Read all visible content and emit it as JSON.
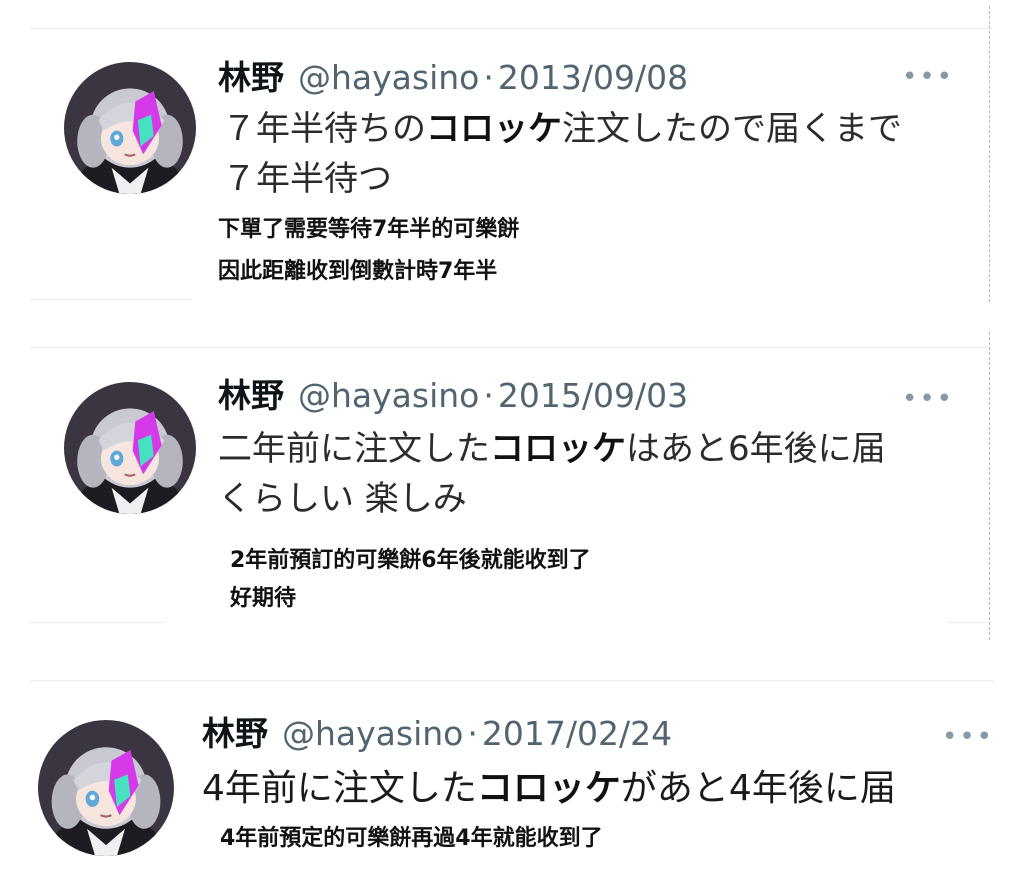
{
  "tweets": [
    {
      "name": "林野",
      "handle": "@hayasino",
      "separator": "·",
      "date": "2013/09/08",
      "text_before": "７年半待ちの",
      "text_bold": "コロッケ",
      "text_after": "注文したので届くまで",
      "text_line2": "７年半待つ",
      "translation_line1": "下單了需要等待7年半的可樂餅",
      "translation_line2": "因此距離收到倒數計時7年半",
      "more_icon": "more-horizontal-icon"
    },
    {
      "name": "林野",
      "handle": "@hayasino",
      "separator": "·",
      "date": "2015/09/03",
      "text_before": "二年前に注文した",
      "text_bold": "コロッケ",
      "text_after": "はあと6年後に届",
      "text_line2": "くらしい 楽しみ",
      "translation_line1": "2年前預訂的可樂餅6年後就能收到了",
      "translation_line2": "好期待",
      "more_icon": "more-horizontal-icon"
    },
    {
      "name": "林野",
      "handle": "@hayasino",
      "separator": "·",
      "date": "2017/02/24",
      "text_before": "4年前に注文した",
      "text_bold": "コロッケ",
      "text_after": "があと4年後に届",
      "translation_line1": "4年前預定的可樂餅再過4年就能收到了",
      "more_icon": "more-horizontal-icon"
    }
  ],
  "colors": {
    "name": "#0f1419",
    "secondary": "#536471",
    "divider": "#e6ecf0"
  }
}
